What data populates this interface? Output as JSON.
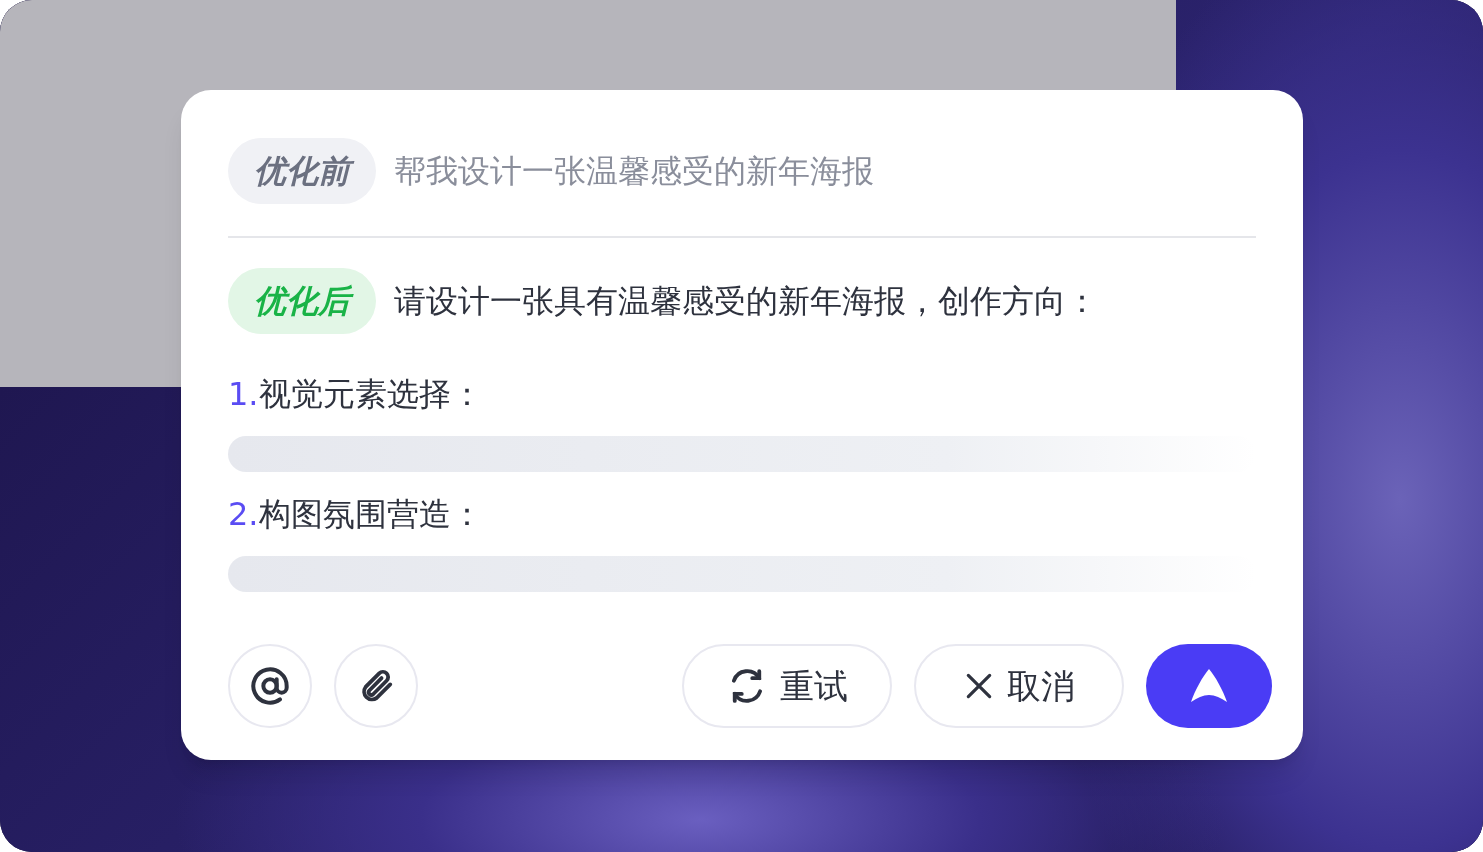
{
  "before": {
    "tag": "优化前",
    "text": "帮我设计一张温馨感受的新年海报"
  },
  "after": {
    "tag": "优化后",
    "text": "请设计一张具有温馨感受的新年海报，创作方向："
  },
  "sections": [
    {
      "number": "1.",
      "title": "视觉元素选择："
    },
    {
      "number": "2.",
      "title": "构图氛围营造："
    }
  ],
  "tools": [
    {
      "kind": "mention"
    },
    {
      "kind": "attach"
    }
  ],
  "buttons": [
    {
      "kind": "retry",
      "label": "重试"
    },
    {
      "kind": "cancel",
      "label": "取消"
    }
  ],
  "send": {
    "kind": "send"
  }
}
